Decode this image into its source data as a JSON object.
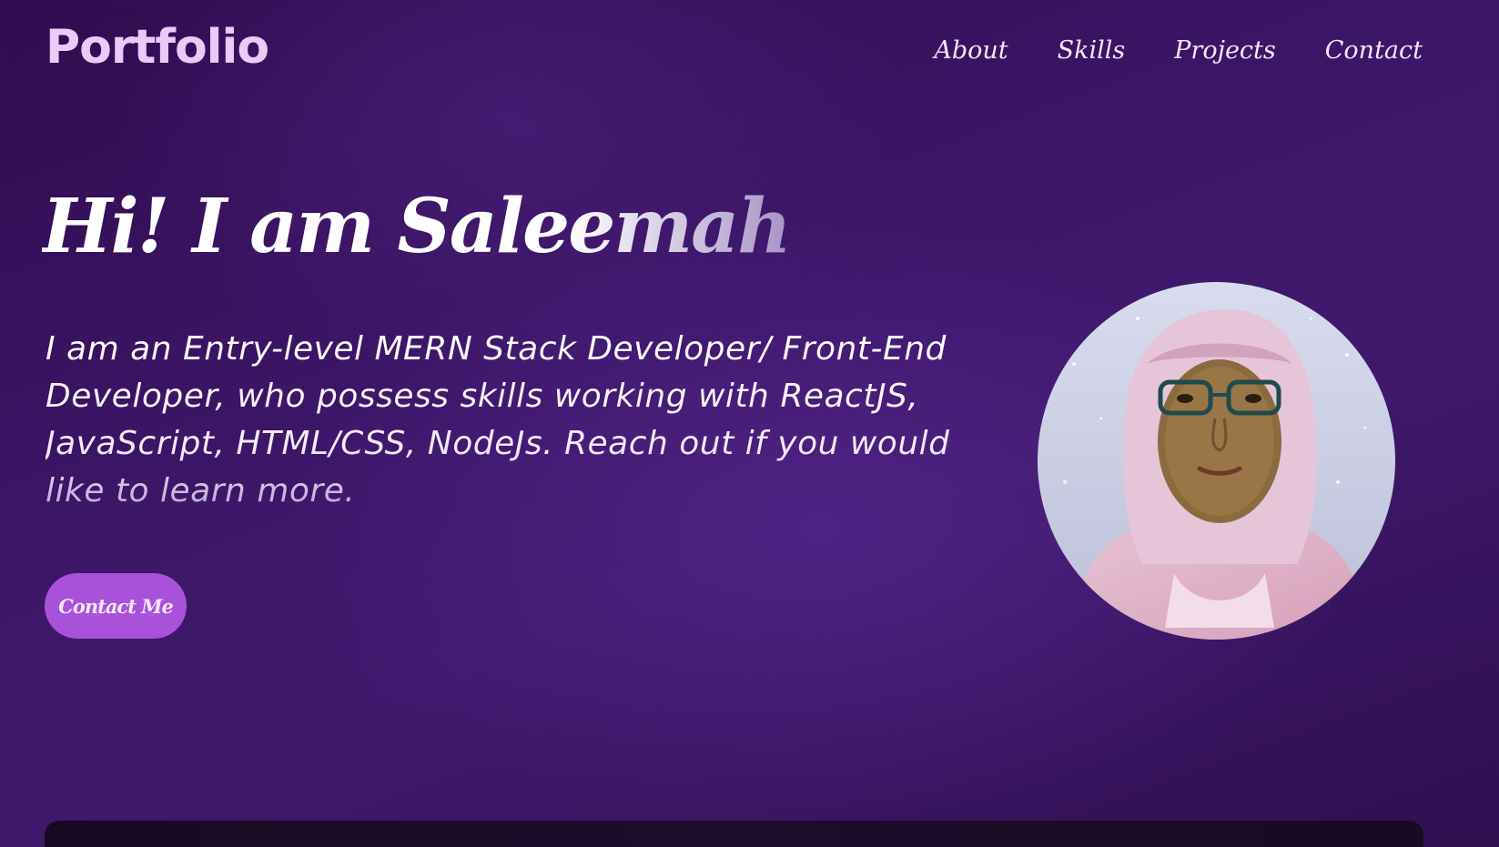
{
  "navbar": {
    "logo": "Portfolio",
    "links": [
      {
        "label": "About"
      },
      {
        "label": "Skills"
      },
      {
        "label": "Projects"
      },
      {
        "label": "Contact"
      }
    ]
  },
  "hero": {
    "title": "Hi! I am Saleemah",
    "description": "I am an Entry-level MERN Stack Developer/ Front-End Developer, who possess skills working with ReactJS, JavaScript, HTML/CSS, NodeJs. Reach out if you would like to learn more.",
    "cta_label": "Contact Me",
    "avatar": "profile-photo"
  },
  "colors": {
    "background": "#3d1668",
    "logo": "#ecc9f7",
    "button": "#a851d9",
    "panel": "#1a0b26"
  }
}
